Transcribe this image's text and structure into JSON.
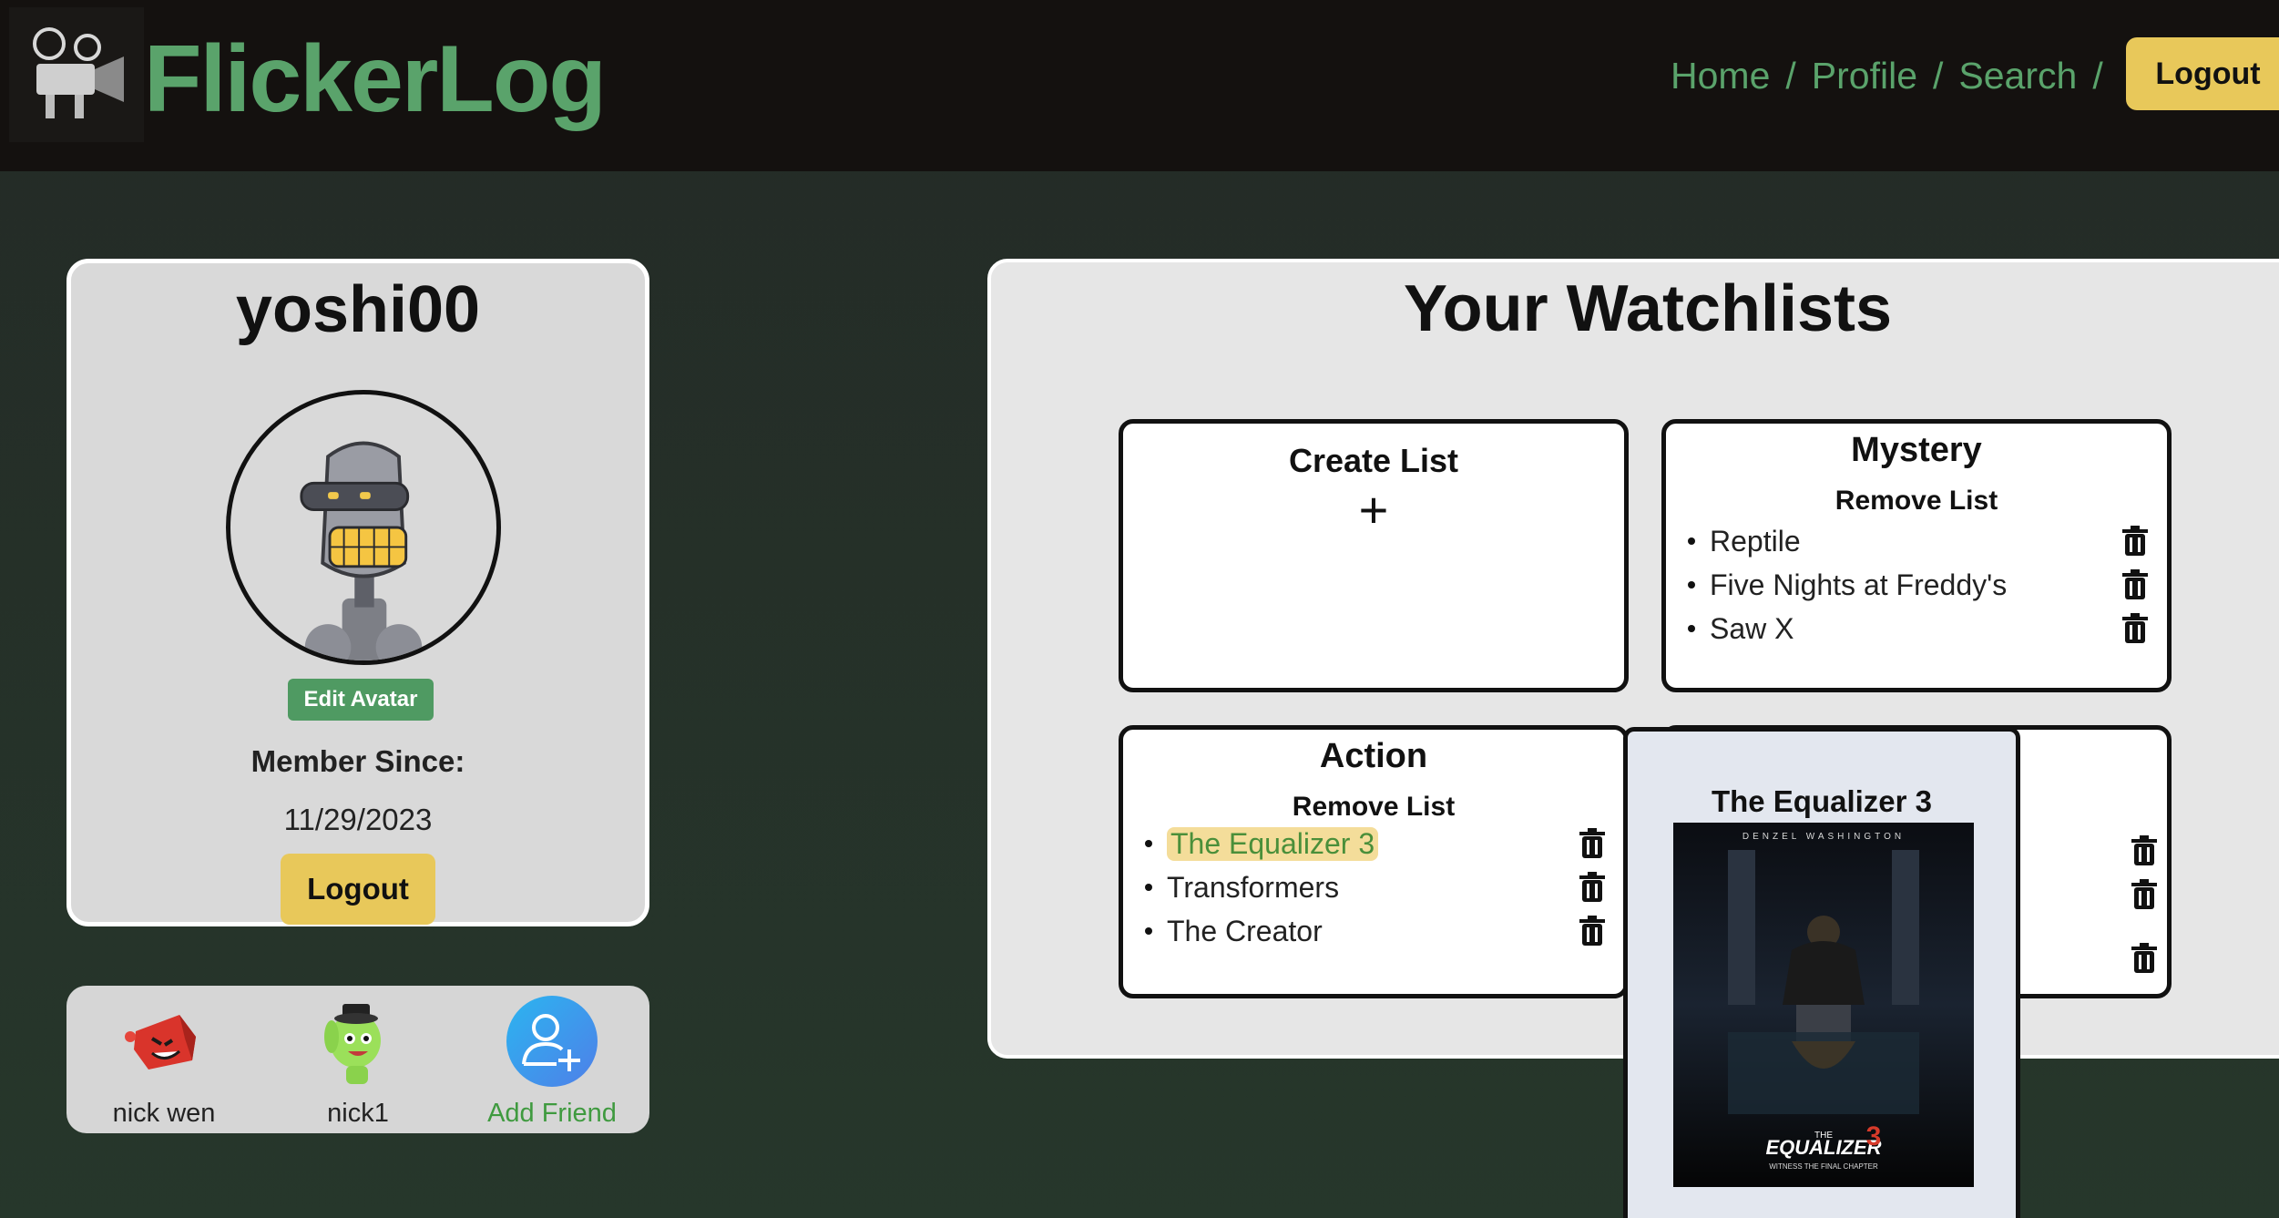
{
  "navbar": {
    "brand": "FlickerLog",
    "links": [
      "Home",
      "Profile",
      "Search"
    ],
    "separator": "/",
    "logout_label": "Logout"
  },
  "profile": {
    "username": "yoshi00",
    "edit_avatar_label": "Edit Avatar",
    "member_since_label": "Member Since:",
    "member_since_date": "11/29/2023",
    "logout_label": "Logout"
  },
  "friends": [
    {
      "name": "nick wen"
    },
    {
      "name": "nick1"
    },
    {
      "name": "Add Friend"
    }
  ],
  "watchlists": {
    "title": "Your Watchlists",
    "create_label": "Create List",
    "create_symbol": "+",
    "remove_label": "Remove List",
    "lists": [
      {
        "name": "Mystery",
        "movies": [
          "Reptile",
          "Five Nights at Freddy's",
          "Saw X"
        ]
      },
      {
        "name": "Action",
        "movies": [
          "The Equalizer 3",
          "Transformers",
          "The Creator"
        ]
      }
    ]
  },
  "popup": {
    "title": "The Equalizer 3",
    "poster_top_text": "DENZEL WASHINGTON",
    "poster_title": "EQUALIZER",
    "poster_prefix": "THE",
    "poster_number": "3",
    "poster_tagline": "WITNESS THE FINAL CHAPTER"
  },
  "colors": {
    "brand_green": "#5aa36b",
    "accent_yellow": "#e8c85a",
    "navbar_bg": "#14110f",
    "page_bg": "#26372b"
  }
}
